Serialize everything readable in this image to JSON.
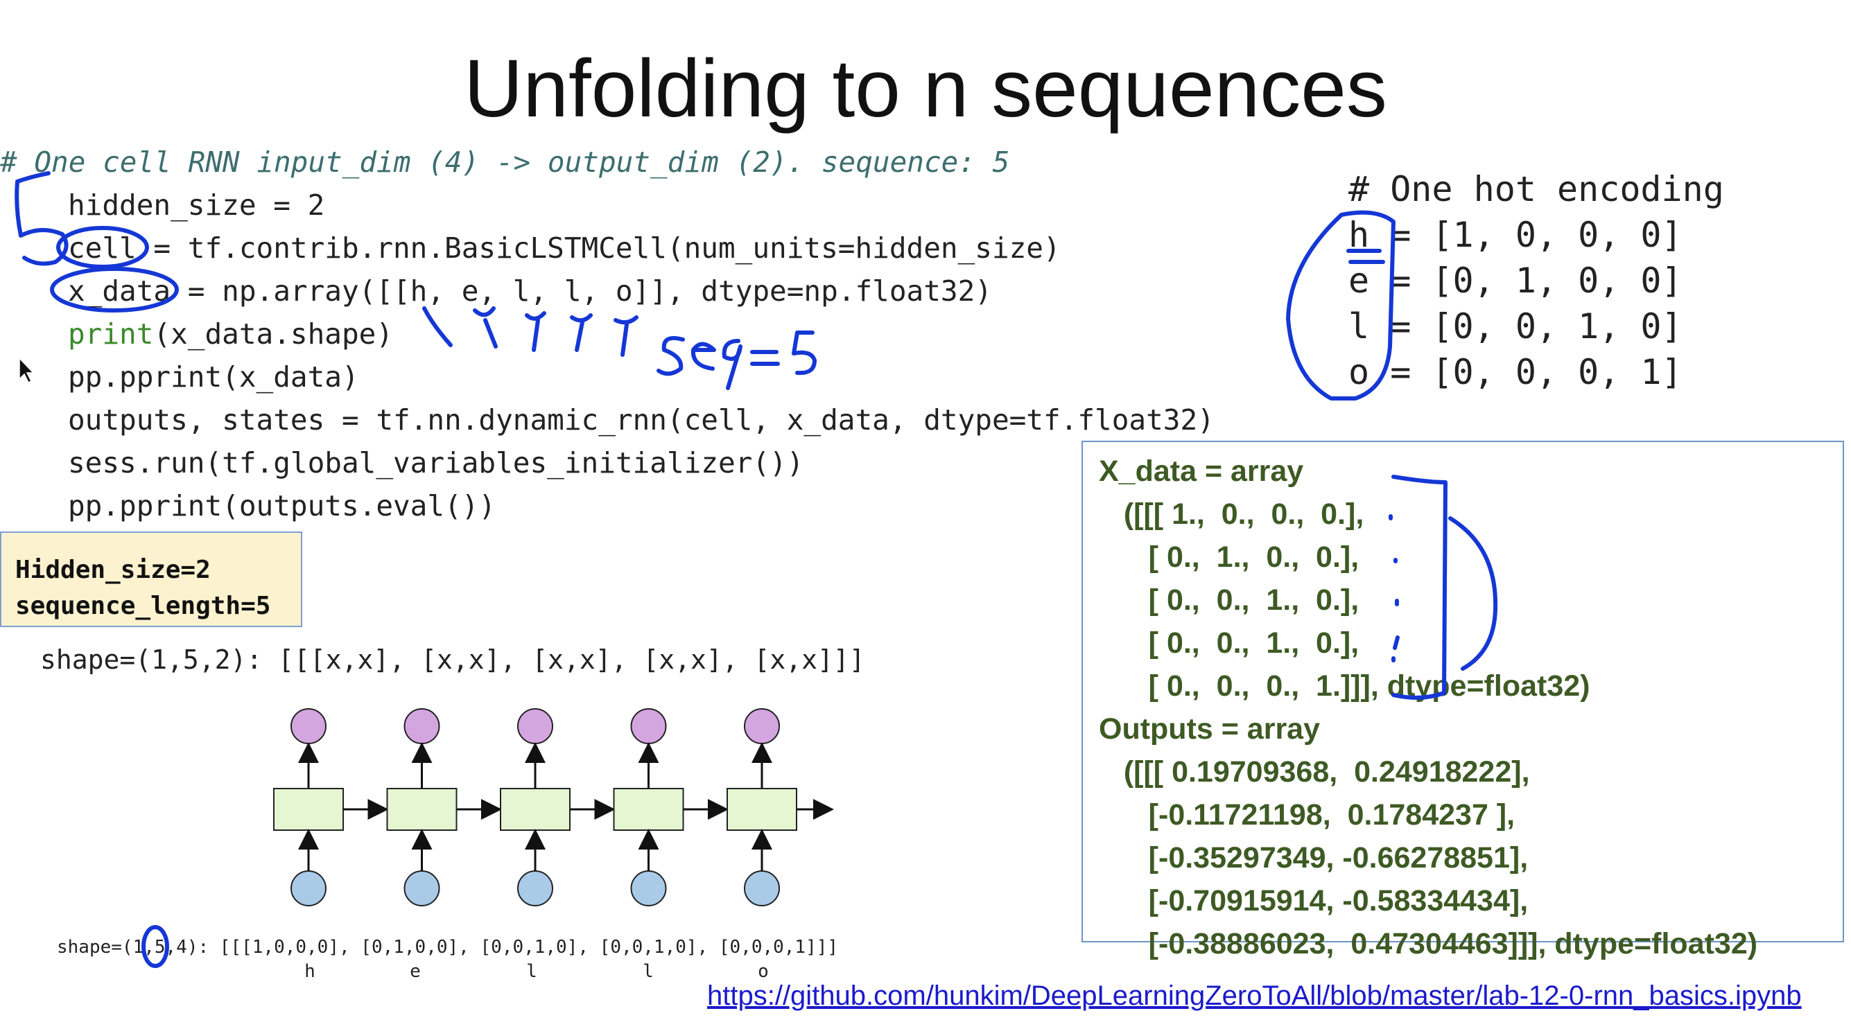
{
  "title": "Unfolding to n sequences",
  "code": {
    "comment": "# One cell RNN input_dim (4) -> output_dim (2). sequence: 5",
    "lines": [
      "hidden_size = 2",
      "cell = tf.contrib.rnn.BasicLSTMCell(num_units=hidden_size)",
      "x_data = np.array([[h, e, l, l, o]], dtype=np.float32)",
      "(x_data.shape)",
      "pp.pprint(x_data)",
      "outputs, states = tf.nn.dynamic_rnn(cell, x_data, dtype=tf.float32)",
      "sess.run(tf.global_variables_initializer())",
      "pp.pprint(outputs.eval())"
    ],
    "print_keyword": "print"
  },
  "onehot": {
    "header": "# One hot encoding",
    "rows": [
      "h = [1, 0, 0, 0]",
      "e = [0, 1, 0, 0]",
      "l = [0, 0, 1, 0]",
      "o = [0, 0, 0, 1]"
    ]
  },
  "note": {
    "line1": "Hidden_size=2",
    "line2": "sequence_length=5"
  },
  "diagram": {
    "output_shape": "shape=(1,5,2): [[[x,x], [x,x], [x,x], [x,x], [x,x]]]",
    "input_shape": "shape=(1,5,4): [[[1,0,0,0], [0,1,0,0], [0,0,1,0], [0,0,1,0], [0,0,0,1]]]",
    "letters": [
      "h",
      "e",
      "l",
      "l",
      "o"
    ],
    "output_color": "#d4a6e0",
    "cell_color": "#e6f5d2",
    "input_color": "#a9cbe8"
  },
  "output_box": {
    "lines": [
      "X_data = array",
      "   ([[[ 1.,  0.,  0.,  0.],",
      "      [ 0.,  1.,  0.,  0.],",
      "      [ 0.,  0.,  1.,  0.],",
      "      [ 0.,  0.,  1.,  0.],",
      "      [ 0.,  0.,  0.,  1.]]], dtype=float32)",
      "Outputs = array",
      "   ([[[ 0.19709368,  0.24918222],",
      "      [-0.11721198,  0.1784237 ],",
      "      [-0.35297349, -0.66278851],",
      "      [-0.70915914, -0.58334434],",
      "      [-0.38886023,  0.47304463]]], dtype=float32)"
    ]
  },
  "handwriting": {
    "seq_note": "seq = 5",
    "ink_color": "#1537d6"
  },
  "link": "https://github.com/hunkim/DeepLearningZeroToAll/blob/master/lab-12-0-rnn_basics.ipynb"
}
